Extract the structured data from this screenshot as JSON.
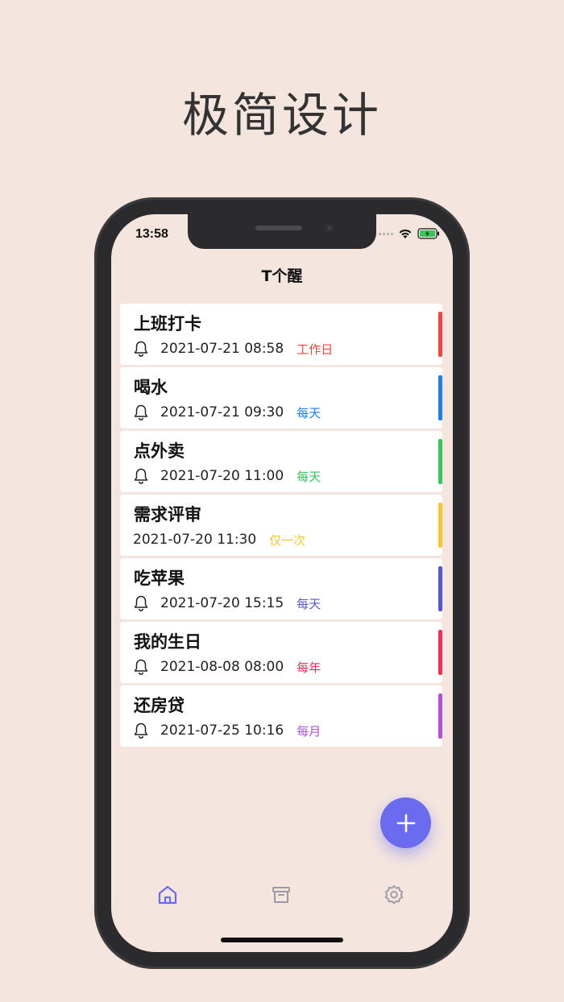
{
  "headline": "极简设计",
  "status": {
    "time": "13:58"
  },
  "app": {
    "title": "T个醒"
  },
  "reminders": [
    {
      "title": "上班打卡",
      "datetime": "2021-07-21 08:58",
      "repeat": "工作日",
      "color": "#f0453a",
      "has_bell": true
    },
    {
      "title": "喝水",
      "datetime": "2021-07-21 09:30",
      "repeat": "每天",
      "color": "#1a80f0",
      "has_bell": true
    },
    {
      "title": "点外卖",
      "datetime": "2021-07-20 11:00",
      "repeat": "每天",
      "color": "#34c759",
      "has_bell": true
    },
    {
      "title": "需求评审",
      "datetime": "2021-07-20 11:30",
      "repeat": "仅一次",
      "color": "#f7c82a",
      "has_bell": false
    },
    {
      "title": "吃苹果",
      "datetime": "2021-07-20 15:15",
      "repeat": "每天",
      "color": "#5856d6",
      "has_bell": true
    },
    {
      "title": "我的生日",
      "datetime": "2021-08-08 08:00",
      "repeat": "每年",
      "color": "#f0305a",
      "has_bell": true
    },
    {
      "title": "还房贷",
      "datetime": "2021-07-25 10:16",
      "repeat": "每月",
      "color": "#af52de",
      "has_bell": true
    }
  ],
  "icons": {
    "bell": "bell-icon",
    "fab": "plus-icon",
    "tab_home": "home-icon",
    "tab_archive": "archive-icon",
    "tab_settings": "gear-icon"
  },
  "colors": {
    "accent": "#6b6bf0",
    "background": "#f4e6df",
    "tab_inactive": "#9a9aa6"
  }
}
